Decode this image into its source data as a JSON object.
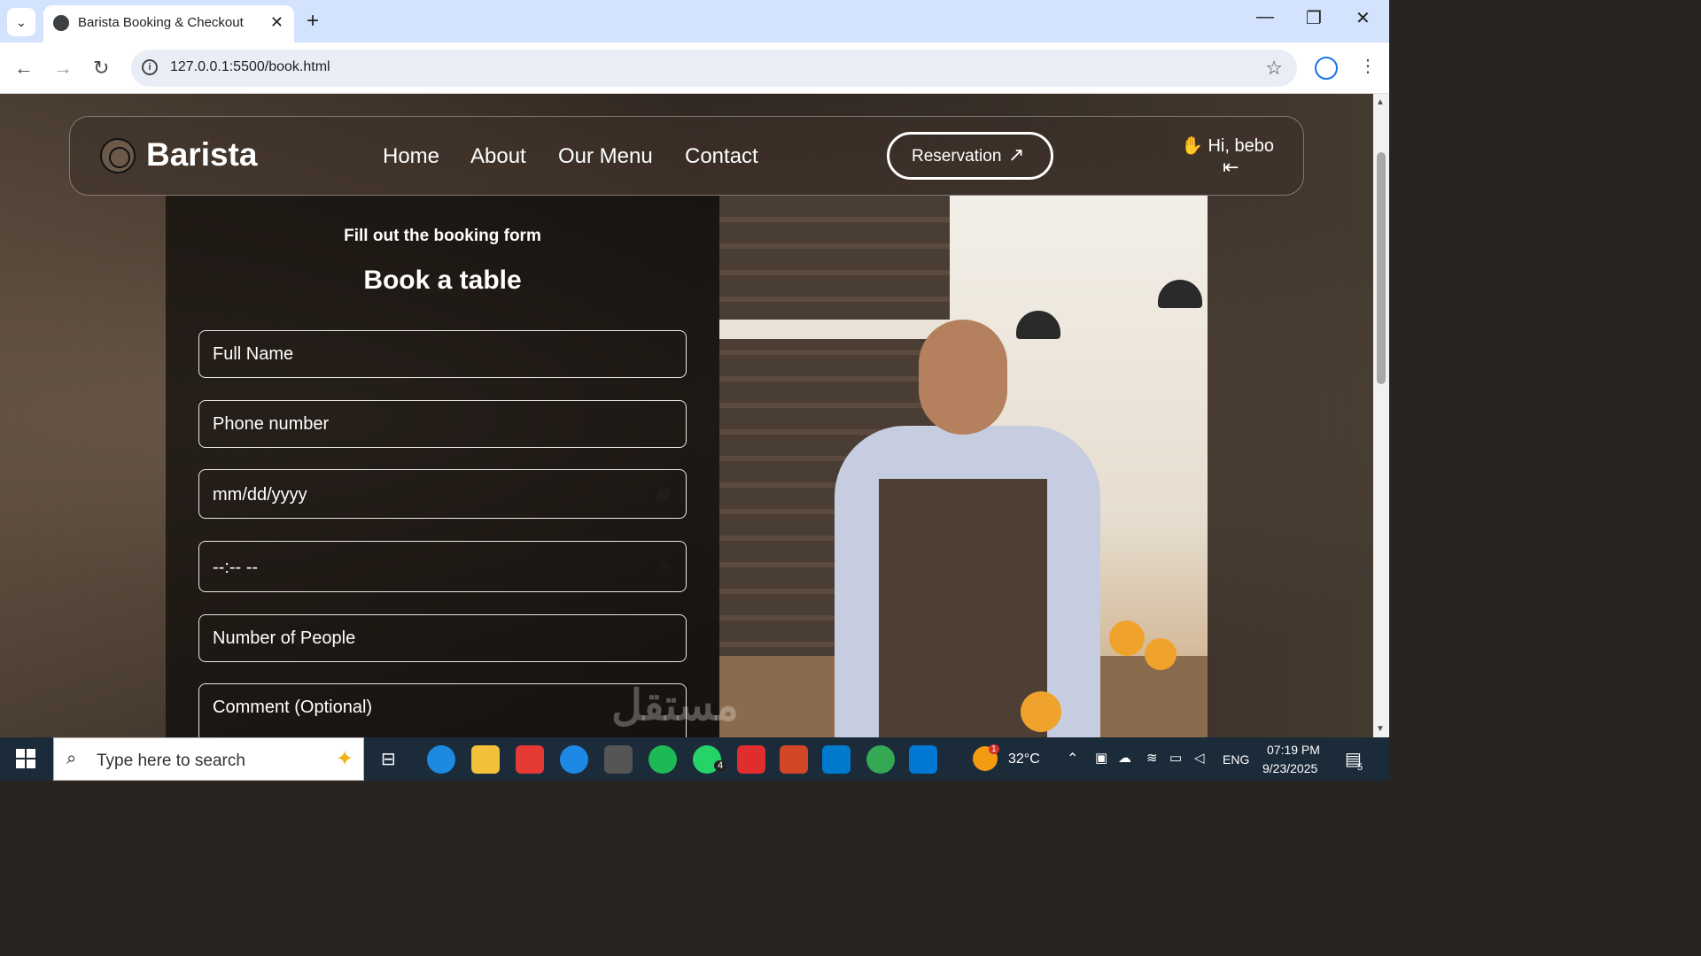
{
  "browser": {
    "tab_title": "Barista Booking & Checkout",
    "tab_close": "✕",
    "new_tab": "+",
    "url": "127.0.0.1:5500/book.html",
    "window_controls": {
      "minimize": "—",
      "restore": "❐",
      "close": "✕"
    }
  },
  "site": {
    "brand": "Barista",
    "nav": [
      "Home",
      "About",
      "Our Menu",
      "Contact"
    ],
    "reservation_label": "Reservation",
    "greeting": "Hi, bebo"
  },
  "form": {
    "kicker": "Fill out the booking form",
    "title": "Book a table",
    "fields": {
      "full_name": "Full Name",
      "phone": "Phone number",
      "date": "mm/dd/yyyy",
      "time": "--:-- --",
      "people": "Number of People",
      "comment": "Comment (Optional)"
    }
  },
  "watermark": "مستقل",
  "taskbar": {
    "search_placeholder": "Type here to search",
    "temperature": "32°C",
    "language": "ENG",
    "time": "07:19 PM",
    "date": "9/23/2025",
    "notification_count": "5",
    "whatsapp_badge": "4",
    "weather_badge": "1"
  },
  "colors": {
    "tab_strip": "#d3e3fd",
    "taskbar": "#1c2b3a",
    "form_panel": "#0c0a09"
  },
  "icons": [
    "globe-icon",
    "info-icon",
    "star-icon",
    "account-icon",
    "logo-icon",
    "arrow-up-right-icon",
    "wave-hand-icon",
    "logout-icon",
    "calendar-icon",
    "clock-icon",
    "windows-start-icon",
    "search-icon"
  ]
}
